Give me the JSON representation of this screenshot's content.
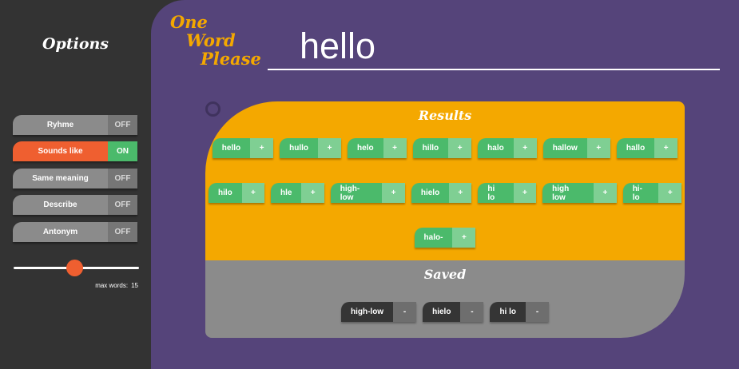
{
  "sidebar": {
    "title": "Options",
    "options": [
      {
        "label": "Ryhme",
        "state": "OFF",
        "active": false
      },
      {
        "label": "Sounds like",
        "state": "ON",
        "active": true
      },
      {
        "label": "Same meaning",
        "state": "OFF",
        "active": false
      },
      {
        "label": "Describe",
        "state": "OFF",
        "active": false
      },
      {
        "label": "Antonym",
        "state": "OFF",
        "active": false
      }
    ],
    "slider": {
      "min": 1,
      "max": 30,
      "value": 15
    },
    "max_words_label": "max words:",
    "max_words_value": "15"
  },
  "header": {
    "logo_line1": "One",
    "logo_line2": "Word",
    "logo_line3": "Please",
    "search_value": "hello"
  },
  "results": {
    "title": "Results",
    "rows": [
      [
        "hello",
        "hullo",
        "helo",
        "hillo",
        "halo",
        "hallow",
        "hallo"
      ],
      [
        "hilo",
        "hle",
        "high-low",
        "hielo",
        "hi lo",
        "high low",
        "hi-lo"
      ],
      [
        "halo-"
      ]
    ],
    "add_label": "+"
  },
  "saved": {
    "title": "Saved",
    "items": [
      "high-low",
      "hielo",
      "hi lo"
    ],
    "remove_label": "-"
  },
  "colors": {
    "sidebar_bg": "#333333",
    "main_bg": "#55447a",
    "accent_orange": "#ef5f30",
    "results_bg": "#f4a800",
    "saved_bg": "#8b8b8b",
    "chip_green": "#4bba6b"
  }
}
